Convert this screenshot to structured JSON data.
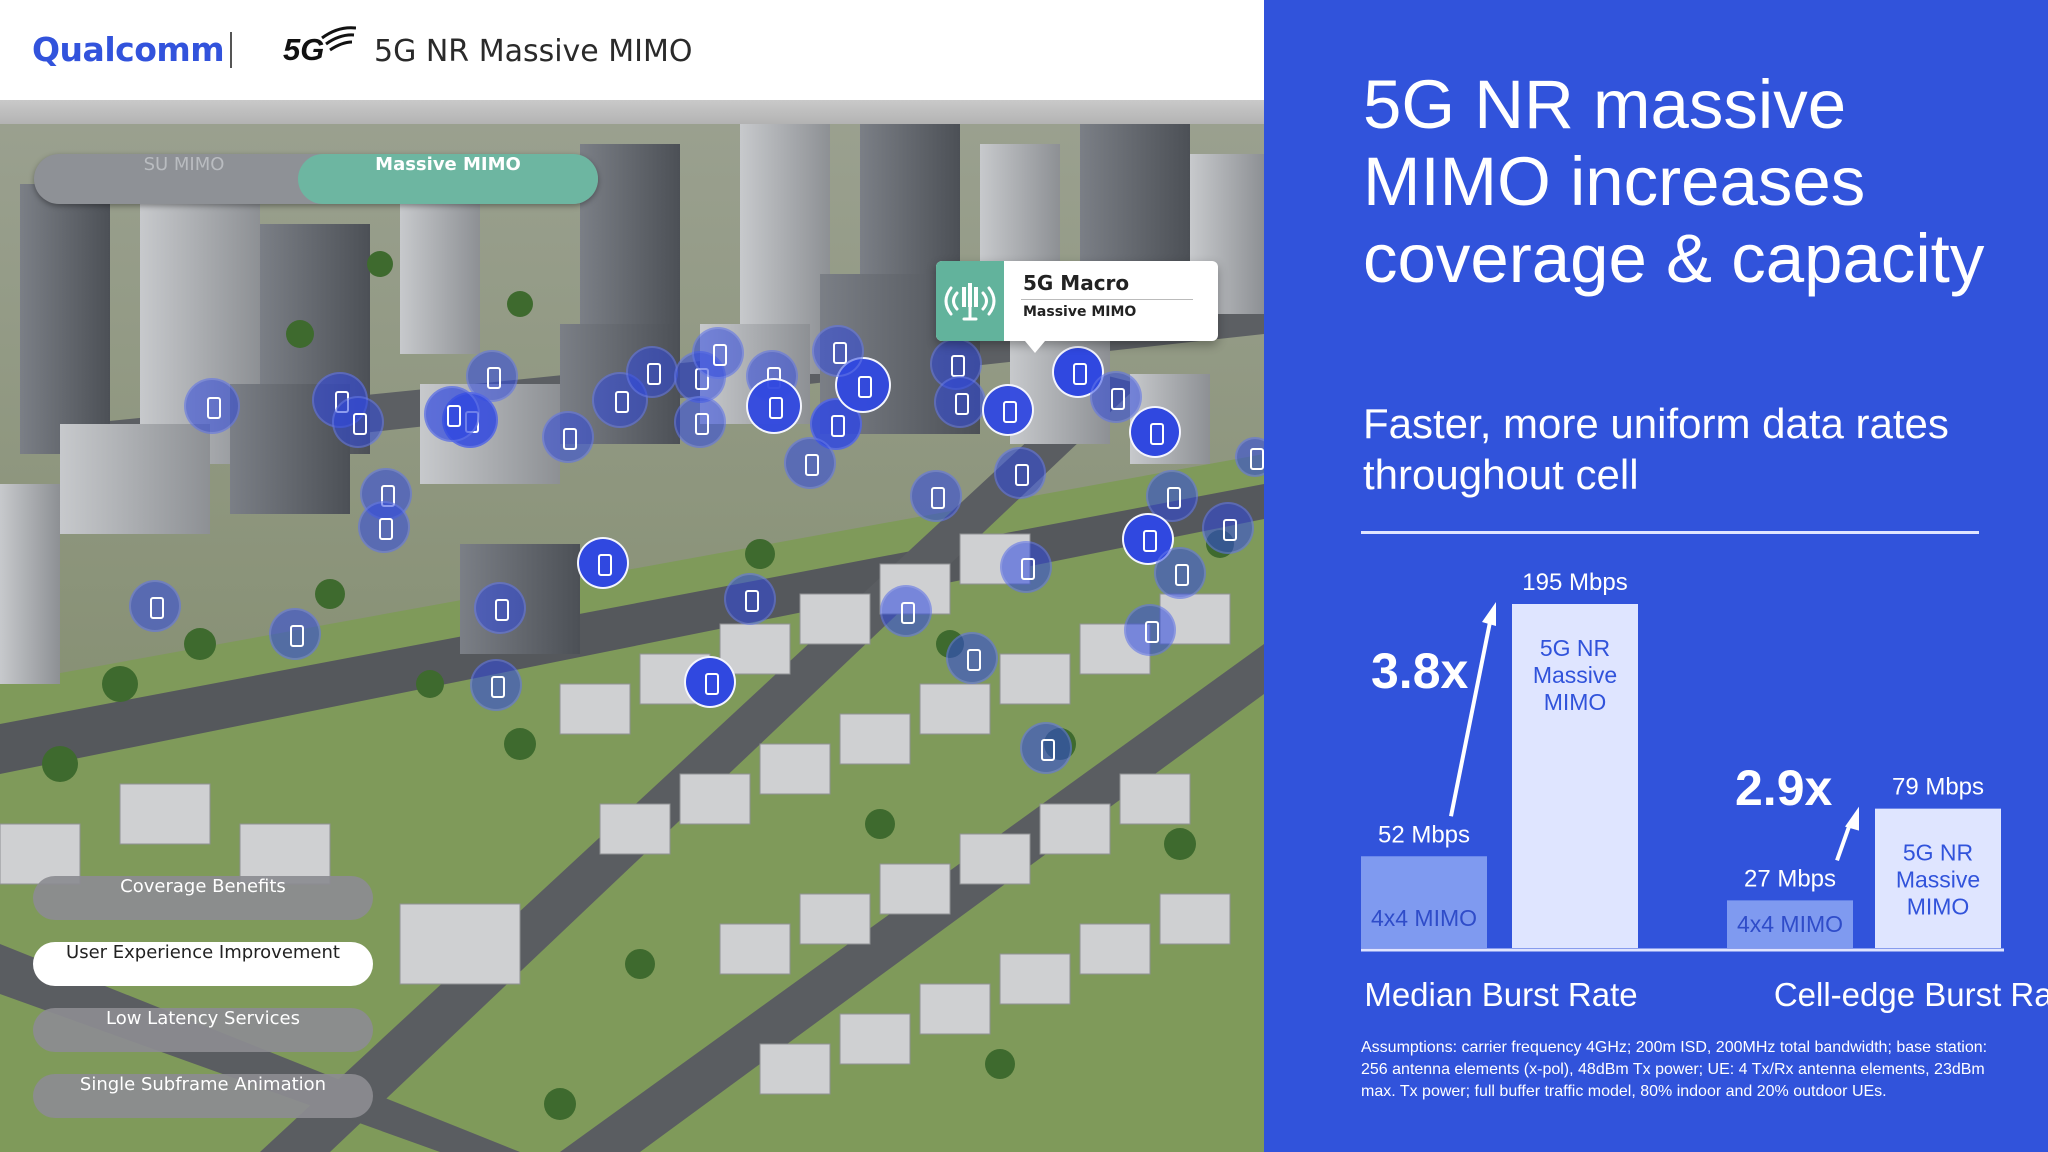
{
  "header": {
    "logo_text": "Qualcomm",
    "fiveg_logo": "5G",
    "title": "5G NR Massive MIMO"
  },
  "scene": {
    "toggle": {
      "option_su": "SU MIMO",
      "option_massive": "Massive MIMO",
      "selected": "Massive MIMO"
    },
    "callout": {
      "title": "5G Macro",
      "subtitle": "Massive MIMO",
      "icon": "antenna-tower-icon"
    },
    "device_icon": "smartphone-icon",
    "menu": [
      {
        "label": "Coverage Benefits",
        "active": false
      },
      {
        "label": "User Experience Improvement",
        "active": true
      },
      {
        "label": "Low Latency Services",
        "active": false
      },
      {
        "label": "Single Subframe Animation",
        "active": false
      }
    ]
  },
  "panel": {
    "title": "5G NR massive MIMO increases coverage & capacity",
    "subtitle": "Faster, more uniform data rates throughout cell",
    "assumptions": "Assumptions: carrier frequency 4GHz; 200m ISD, 200MHz total bandwidth; base station: 256 antenna elements (x-pol), 48dBm Tx power; UE: 4 Tx/Rx antenna elements, 23dBm max. Tx power; full buffer traffic model, 80% indoor and 20% outdoor UEs.",
    "colors": {
      "background": "#3153db",
      "bar_4x4": "#7f9af0",
      "bar_massive": "#dfe5ff"
    }
  },
  "chart_data": {
    "type": "bar",
    "unit": "Mbps",
    "groups": [
      {
        "category": "Median Burst Rate",
        "multiplier": "3.8x",
        "bars": [
          {
            "label": "4x4 MIMO",
            "value": 52,
            "value_label": "52 Mbps"
          },
          {
            "label": "5G NR Massive MIMO",
            "value": 195,
            "value_label": "195 Mbps"
          }
        ]
      },
      {
        "category": "Cell-edge Burst Rate",
        "multiplier": "2.9x",
        "bars": [
          {
            "label": "4x4 MIMO",
            "value": 27,
            "value_label": "27 Mbps"
          },
          {
            "label": "5G NR Massive MIMO",
            "value": 79,
            "value_label": "79 Mbps"
          }
        ]
      }
    ]
  }
}
